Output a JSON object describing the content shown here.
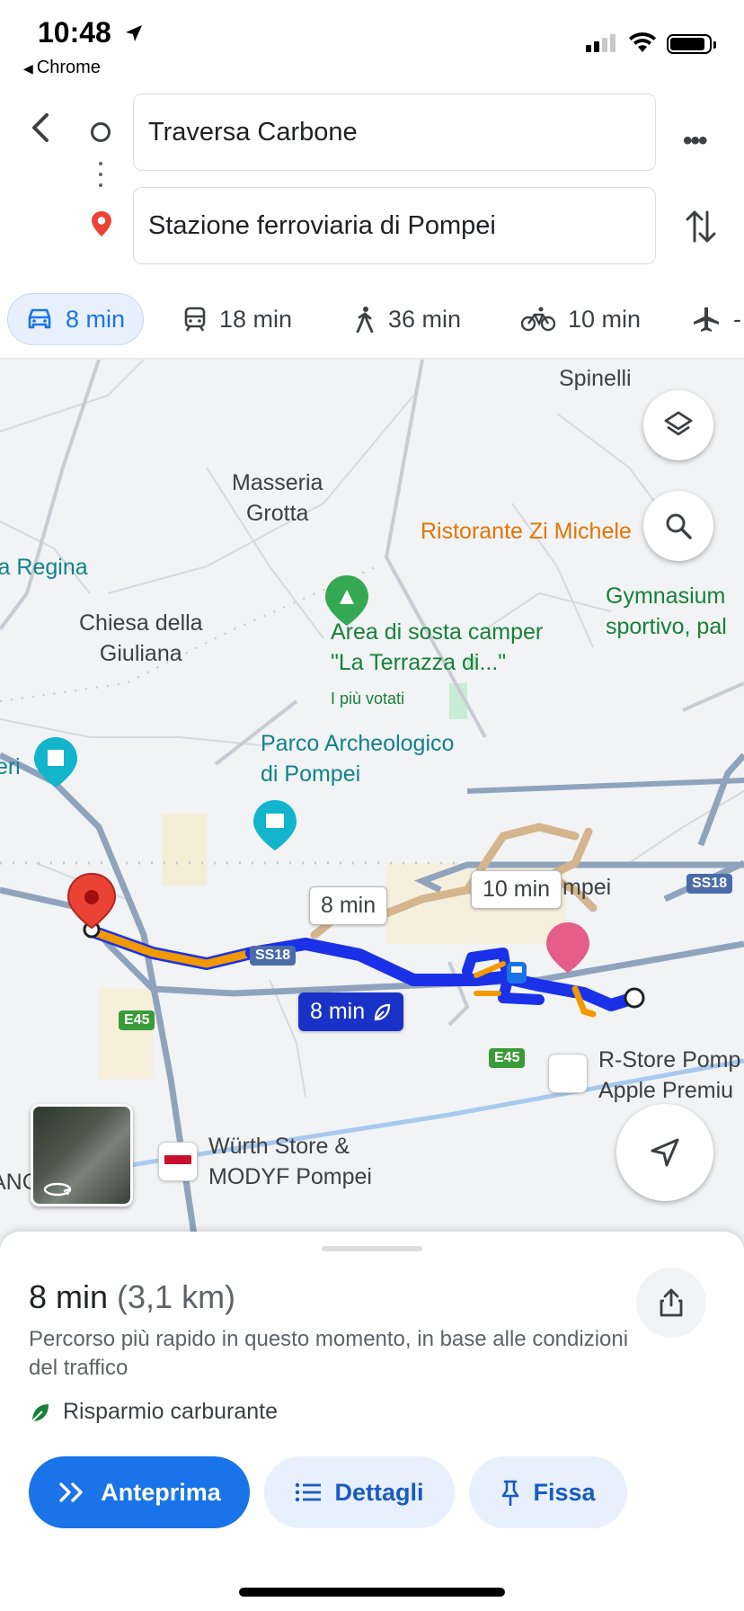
{
  "status_bar": {
    "time": "10:48",
    "back_app": "Chrome",
    "location_icon": "location-arrow-icon",
    "signal_bars": 2
  },
  "header": {
    "origin": "Traversa Carbone",
    "destination": "Stazione ferroviaria di Pompei"
  },
  "modes": [
    {
      "icon": "car-icon",
      "label": "8 min",
      "active": true
    },
    {
      "icon": "train-icon",
      "label": "18 min",
      "active": false
    },
    {
      "icon": "walk-icon",
      "label": "36 min",
      "active": false
    },
    {
      "icon": "bike-icon",
      "label": "10 min",
      "active": false
    },
    {
      "icon": "plane-icon",
      "label": "-",
      "active": false
    }
  ],
  "map": {
    "labels": {
      "spinelli": "Spinelli",
      "masseria": "Masseria\nGrotta",
      "ristorante": "Ristorante Zi Michele",
      "regina": "la Regina",
      "chiesa": "Chiesa della\nGiuliana",
      "area_sosta": "Area di sosta camper\n\"La Terrazza di...\"",
      "piu_votati": "I più votati",
      "gymnasium": "Gymnasium\nsportivo, pal",
      "parco": "Parco Archeologico\ndi Pompei",
      "eri": "teri",
      "pompei": "mpei",
      "rstore": "R-Store Pomp\nApple Premiu",
      "wurth": "Würth Store &\nMODYF Pompei",
      "anc": "ANC"
    },
    "roads": {
      "ss18_a": "SS18",
      "ss18_b": "SS18",
      "e45_a": "E45",
      "e45_b": "E45"
    },
    "route_bubbles": {
      "alt1": "8 min",
      "alt2": "10 min",
      "selected": "8 min"
    },
    "colors": {
      "route_selected": "#1a31e8",
      "traffic_orange": "#f29900",
      "route_alt": "#d2b48c",
      "destination_pin": "#ea4335"
    }
  },
  "sheet": {
    "duration": "8 min",
    "distance": "(3,1 km)",
    "description": "Percorso più rapido in questo momento, in base alle condizioni del traffico",
    "eco_label": "Risparmio carburante",
    "buttons": {
      "preview": "Anteprima",
      "details": "Dettagli",
      "pin": "Fissa"
    }
  }
}
